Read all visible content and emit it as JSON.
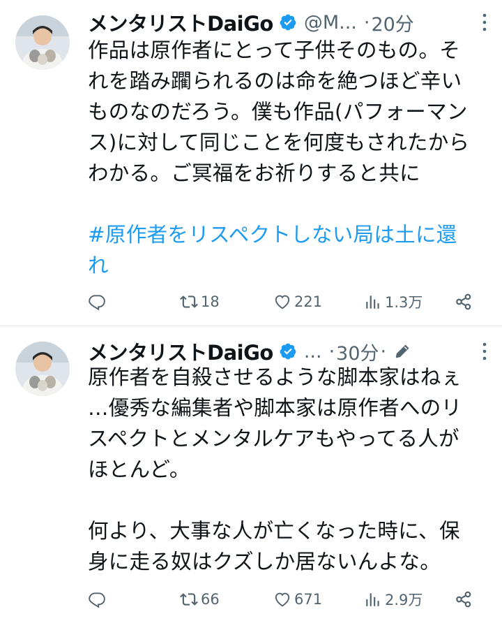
{
  "tweets": [
    {
      "display_name": "メンタリストDaiGo",
      "handle": "@M...",
      "separator": "·",
      "time": "20分",
      "body_lines": [
        "作品は原作者にとって子供そのもの。そ",
        "れを踏み躙られるのは命を絶つほど辛い",
        "ものなのだろう。僕も作品(パフォーマン",
        "ス)に対して同じことを何度もされたから",
        "わかる。ご冥福をお祈りすると共に"
      ],
      "hashtag_lines": [
        "#原作者をリスペクトしない局は土に還",
        "れ"
      ],
      "stats": {
        "retweets": "18",
        "likes": "221",
        "views": "1.3万"
      }
    },
    {
      "display_name": "メンタリストDaiGo",
      "handle": "...",
      "separator": "·",
      "time": "30分",
      "time_suffix": "·",
      "body_lines": [
        "原作者を自殺させるような脚本家はねぇ",
        "…優秀な編集者や脚本家は原作者へのリ",
        "スペクトとメンタルケアもやってる人が",
        "ほとんど。"
      ],
      "body_lines_2": [
        "何より、大事な人が亡くなった時に、保",
        "身に走る奴はクズしか居ないんよな。"
      ],
      "stats": {
        "retweets": "66",
        "likes": "671",
        "views": "2.9万"
      }
    }
  ],
  "icons": {
    "verified": "verified-badge-icon",
    "reply": "reply-icon",
    "retweet": "retweet-icon",
    "like": "heart-icon",
    "views": "views-icon",
    "share": "share-icon",
    "more": "more-icon",
    "edit": "edit-pencil-icon"
  },
  "colors": {
    "text": "#0f1419",
    "secondary": "#536471",
    "link": "#1d9bf0",
    "verified": "#1d9bf0"
  }
}
